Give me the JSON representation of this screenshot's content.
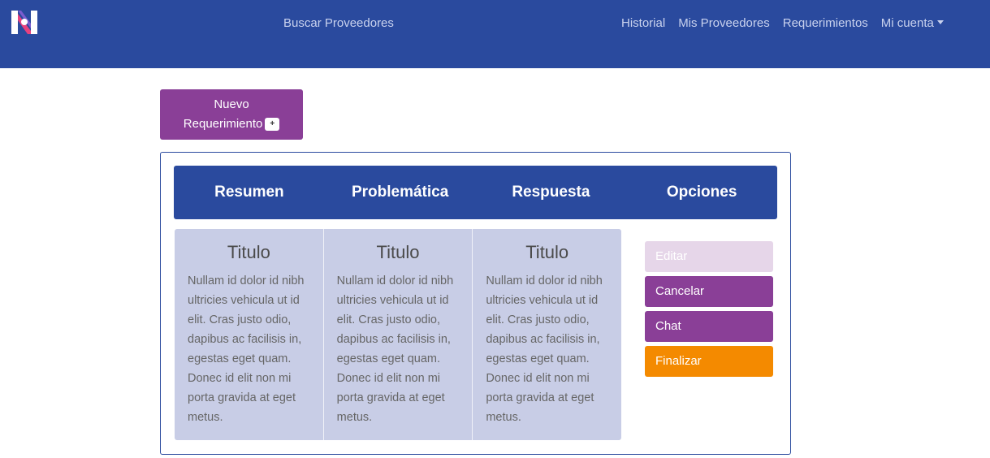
{
  "nav": {
    "search": "Buscar Proveedores",
    "links": [
      "Historial",
      "Mis Proveedores",
      "Requerimientos",
      "Mi cuenta"
    ]
  },
  "new_request": {
    "line1": "Nuevo",
    "line2": "Requerimiento",
    "badge": "+"
  },
  "table_headers": [
    "Resumen",
    "Problemática",
    "Respuesta",
    "Opciones"
  ],
  "columns": [
    {
      "title": "Titulo",
      "text": "Nullam id dolor id nibh ultricies vehicula ut id elit. Cras justo odio, dapibus ac facilisis in, egestas eget quam. Donec id elit non mi porta gravida at eget metus."
    },
    {
      "title": "Titulo",
      "text": "Nullam id dolor id nibh ultricies vehicula ut id elit. Cras justo odio, dapibus ac facilisis in, egestas eget quam. Donec id elit non mi porta gravida at eget metus."
    },
    {
      "title": "Titulo",
      "text": "Nullam id dolor id nibh ultricies vehicula ut id elit. Cras justo odio, dapibus ac facilisis in, egestas eget quam. Donec id elit non mi porta gravida at eget metus."
    }
  ],
  "options": [
    "Editar",
    "Cancelar",
    "Chat",
    "Finalizar"
  ],
  "colors": {
    "primary": "#2a4a9e",
    "purple": "#8a3f97",
    "orange": "#f48a00",
    "light_purple": "#e6d6e9",
    "card": "#c8cde6"
  }
}
